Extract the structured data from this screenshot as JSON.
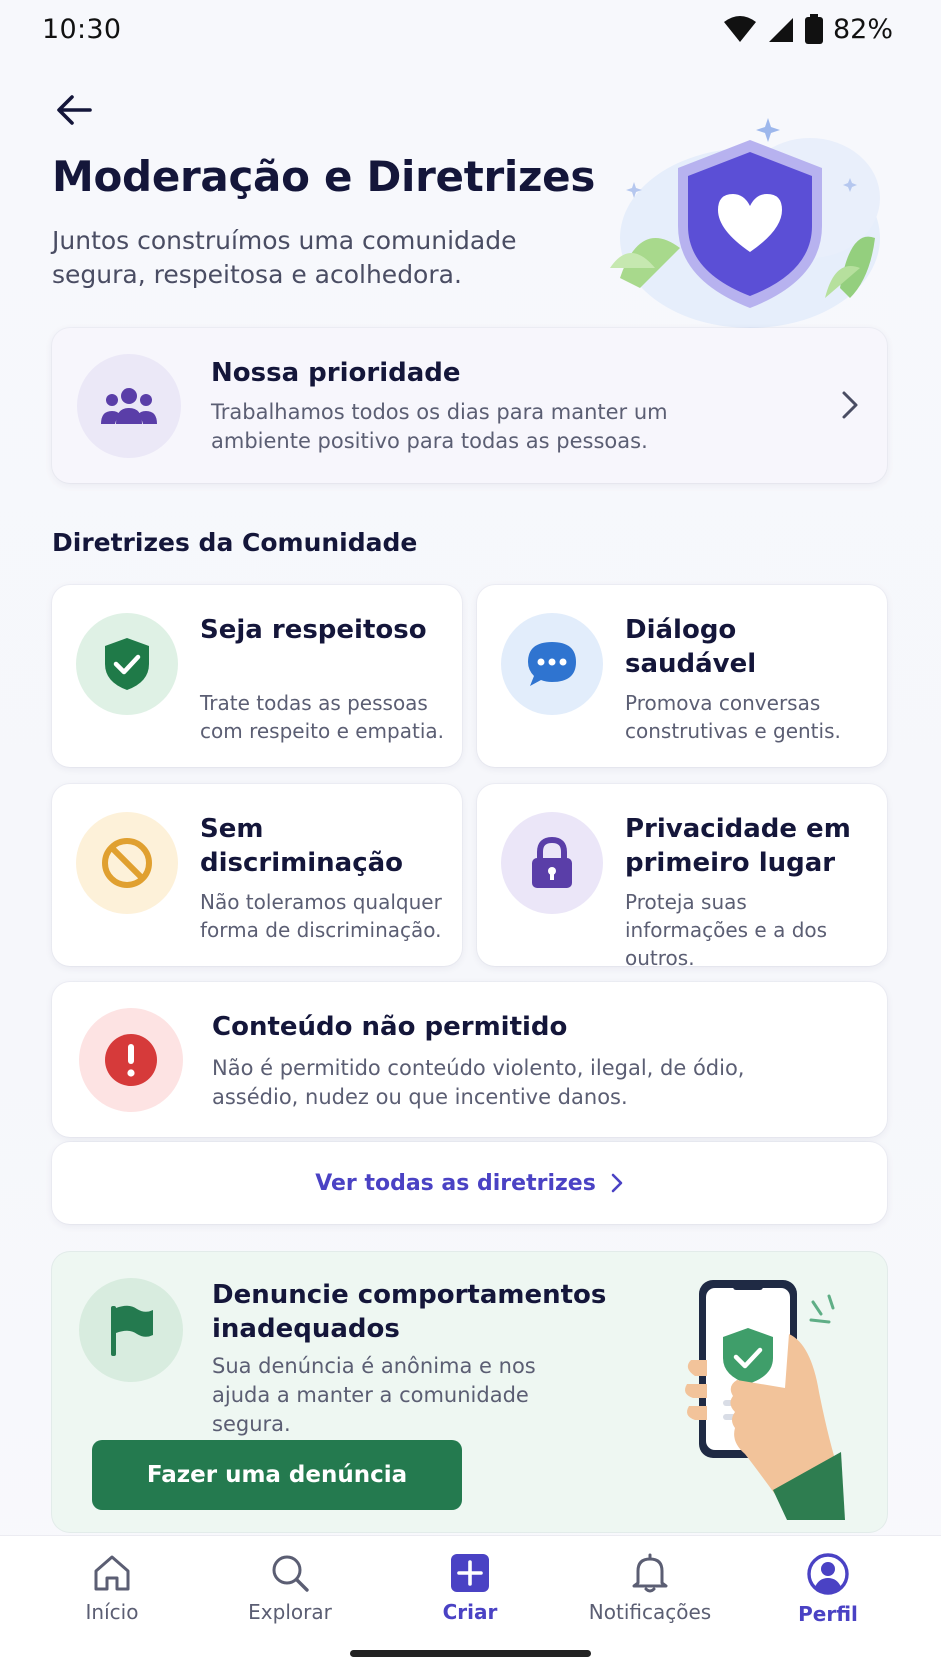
{
  "status_bar": {
    "time": "10:30",
    "battery": "82%"
  },
  "header": {
    "title": "Moderação e Diretrizes",
    "subtitle": "Juntos construímos uma comunidade segura, respeitosa e acolhedora."
  },
  "priority": {
    "title": "Nossa prioridade",
    "description": "Trabalhamos todos os dias para manter um ambiente positivo para todas as pessoas."
  },
  "guidelines": {
    "heading": "Diretrizes da Comunidade",
    "items": [
      {
        "title": "Seja respeitoso",
        "description": "Trate todas as pessoas com respeito e empatia.",
        "icon": "shield-check-icon",
        "color": "#1f7a48"
      },
      {
        "title": "Diálogo saudável",
        "description": "Promova conversas construtivas e gentis.",
        "icon": "chat-bubble-icon",
        "color": "#2f74d0"
      },
      {
        "title": "Sem discriminação",
        "description": "Não toleramos qualquer forma de discriminação.",
        "icon": "prohibited-icon",
        "color": "#e0a030"
      },
      {
        "title": "Privacidade em primeiro lugar",
        "description": "Proteja suas informações e a dos outros.",
        "icon": "lock-icon",
        "color": "#5a3ea8"
      }
    ],
    "forbidden": {
      "title": "Conteúdo não permitido",
      "description": "Não é permitido conteúdo violento, ilegal, de ódio, assédio, nudez ou que incentive danos.",
      "icon": "alert-icon",
      "color": "#d63a3a"
    },
    "see_all": "Ver todas as diretrizes"
  },
  "report": {
    "title": "Denuncie comportamentos inadequados",
    "description": "Sua denúncia é anônima e nos ajuda a manter a comunidade segura.",
    "button": "Fazer uma denúncia",
    "color": "#247a4f"
  },
  "bottom_nav": {
    "items": [
      {
        "label": "Início",
        "icon": "home-icon"
      },
      {
        "label": "Explorar",
        "icon": "search-icon"
      },
      {
        "label": "Criar",
        "icon": "plus-icon"
      },
      {
        "label": "Notificações",
        "icon": "bell-icon"
      },
      {
        "label": "Perfil",
        "icon": "profile-icon"
      }
    ],
    "accent": "#4a42c4"
  }
}
